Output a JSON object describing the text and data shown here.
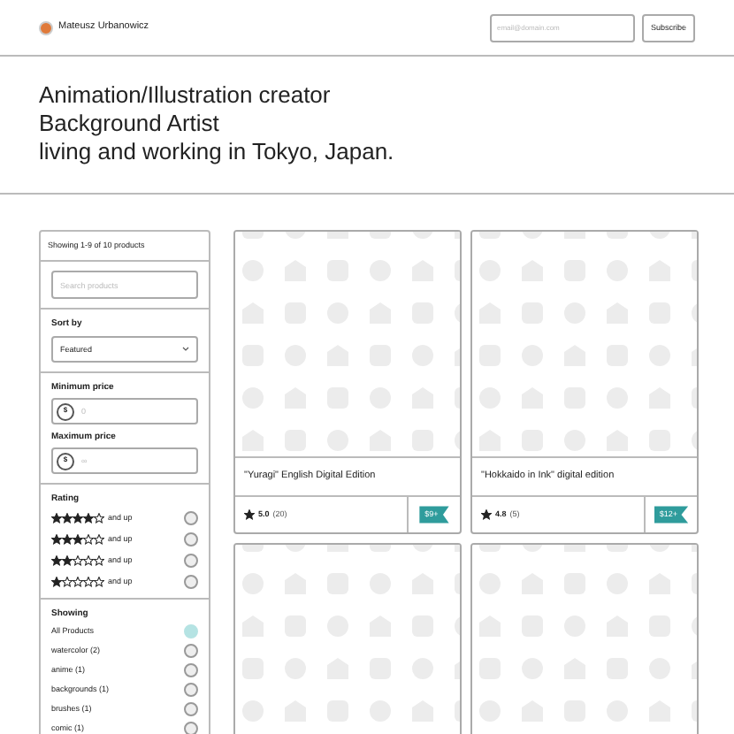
{
  "header": {
    "name": "Mateusz Urbanowicz",
    "email": {
      "placeholder": "email@domain.com"
    },
    "subscribe": "Subscribe"
  },
  "hero": [
    "Animation/Illustration creator",
    "Background Artist",
    "living and working in Tokyo, Japan."
  ],
  "sidebar": {
    "count": "Showing 1-9 of 10 products",
    "search": {
      "placeholder": "Search products"
    },
    "sort": {
      "label": "Sort by",
      "value": "Featured"
    },
    "min_price": {
      "label": "Minimum price",
      "currency": "$",
      "placeholder": "0"
    },
    "max_price": {
      "label": "Maximum price",
      "currency": "$",
      "placeholder": "∞"
    },
    "rating": {
      "label": "Rating",
      "options": [
        {
          "stars": 4,
          "text": "and up",
          "selected": false
        },
        {
          "stars": 3,
          "text": "and up",
          "selected": false
        },
        {
          "stars": 2,
          "text": "and up",
          "selected": false
        },
        {
          "stars": 1,
          "text": "and up",
          "selected": false
        }
      ]
    },
    "showing": {
      "label": "Showing",
      "options": [
        {
          "label": "All Products",
          "selected": true
        },
        {
          "label": "watercolor (2)",
          "selected": false
        },
        {
          "label": "anime (1)",
          "selected": false
        },
        {
          "label": "backgrounds (1)",
          "selected": false
        },
        {
          "label": "brushes (1)",
          "selected": false
        },
        {
          "label": "comic (1)",
          "selected": false
        }
      ]
    }
  },
  "products": [
    {
      "kind": "full",
      "title": "\"Yuragi\" English Digital Edition",
      "rating": "5.0",
      "reviews": "(20)",
      "price": "$9+"
    },
    {
      "kind": "full",
      "title": "\"Hokkaido in Ink\" digital edition",
      "rating": "4.8",
      "reviews": "(5)",
      "price": "$12+"
    },
    {
      "kind": "image"
    },
    {
      "kind": "image"
    }
  ]
}
